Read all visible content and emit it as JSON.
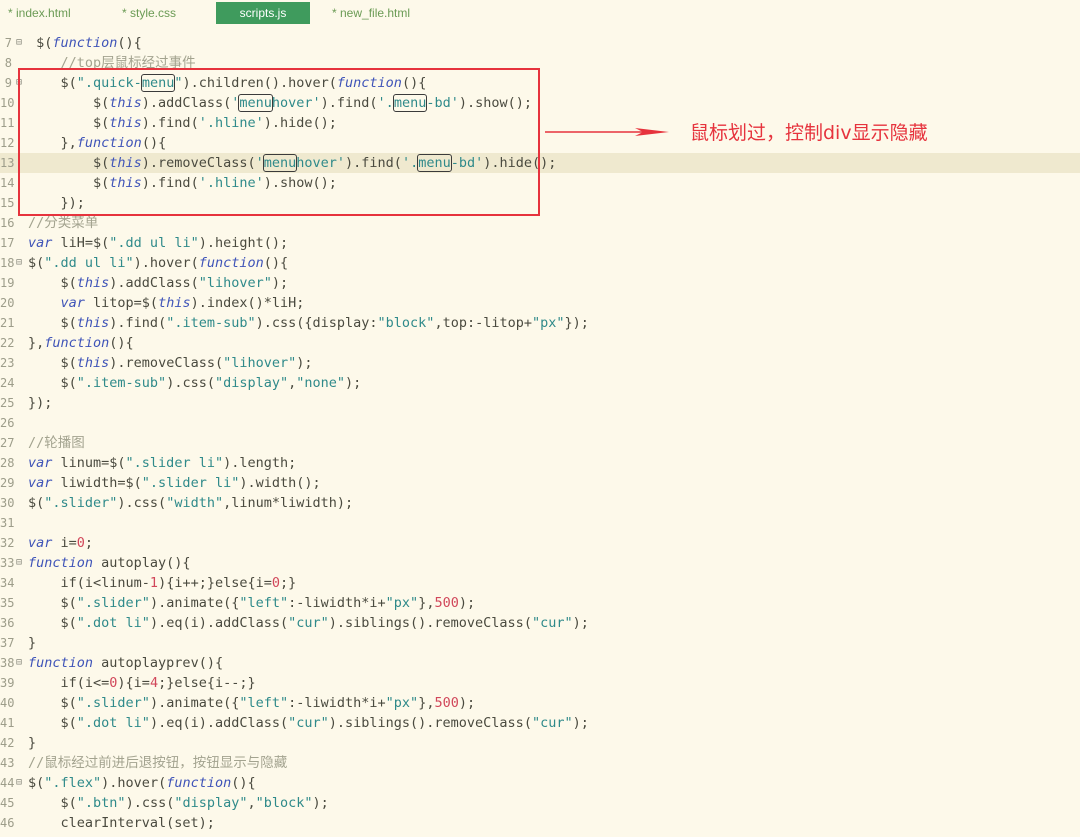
{
  "tabs": [
    {
      "label": "* index.html",
      "active": false
    },
    {
      "label": "* style.css",
      "active": false
    },
    {
      "label": "scripts.js",
      "active": true
    },
    {
      "label": "* new_file.html",
      "active": false
    }
  ],
  "annotation": {
    "text": "鼠标划过，控制div显示隐藏",
    "color": "#e6333d"
  },
  "lines": [
    {
      "n": "7",
      "fold": "⊟",
      "hl": false,
      "parts": [
        [
          "p",
          " $("
        ],
        [
          "kw",
          "function"
        ],
        [
          "p",
          "(){"
        ]
      ]
    },
    {
      "n": "8",
      "fold": "",
      "hl": false,
      "parts": [
        [
          "cm",
          "    //top层鼠标经过事件"
        ]
      ]
    },
    {
      "n": "9",
      "fold": "⊟",
      "hl": false,
      "parts": [
        [
          "p",
          "    $("
        ],
        [
          "str",
          "\".quick-"
        ],
        [
          "strbox",
          "menu"
        ],
        [
          "str",
          "\""
        ],
        [
          "p",
          ").children().hover("
        ],
        [
          "kw",
          "function"
        ],
        [
          "p",
          "(){"
        ]
      ]
    },
    {
      "n": "10",
      "fold": "",
      "hl": false,
      "parts": [
        [
          "p",
          "        $("
        ],
        [
          "kw",
          "this"
        ],
        [
          "p",
          ").addClass("
        ],
        [
          "str",
          "'"
        ],
        [
          "strbox",
          "menu"
        ],
        [
          "str",
          "hover'"
        ],
        [
          "p",
          ").find("
        ],
        [
          "str",
          "'."
        ],
        [
          "strbox",
          "menu"
        ],
        [
          "str",
          "-bd'"
        ],
        [
          "p",
          ").show();"
        ]
      ]
    },
    {
      "n": "11",
      "fold": "",
      "hl": false,
      "parts": [
        [
          "p",
          "        $("
        ],
        [
          "kw",
          "this"
        ],
        [
          "p",
          ").find("
        ],
        [
          "str",
          "'.hline'"
        ],
        [
          "p",
          ").hide();"
        ]
      ]
    },
    {
      "n": "12",
      "fold": "",
      "hl": false,
      "parts": [
        [
          "p",
          "    },"
        ],
        [
          "kw",
          "function"
        ],
        [
          "p",
          "(){"
        ]
      ]
    },
    {
      "n": "13",
      "fold": "",
      "hl": true,
      "parts": [
        [
          "p",
          "        $("
        ],
        [
          "kw",
          "this"
        ],
        [
          "p",
          ").removeClass("
        ],
        [
          "str",
          "'"
        ],
        [
          "strbox",
          "menu"
        ],
        [
          "str",
          "hover'"
        ],
        [
          "p",
          ").find("
        ],
        [
          "str",
          "'."
        ],
        [
          "strbox",
          "menu"
        ],
        [
          "str",
          "-bd'"
        ],
        [
          "p",
          ").hide();"
        ]
      ]
    },
    {
      "n": "14",
      "fold": "",
      "hl": false,
      "parts": [
        [
          "p",
          "        $("
        ],
        [
          "kw",
          "this"
        ],
        [
          "p",
          ").find("
        ],
        [
          "str",
          "'.hline'"
        ],
        [
          "p",
          ").show();"
        ]
      ]
    },
    {
      "n": "15",
      "fold": "",
      "hl": false,
      "parts": [
        [
          "p",
          "    });"
        ]
      ]
    },
    {
      "n": "16",
      "fold": "",
      "hl": false,
      "parts": [
        [
          "cm",
          "//分类菜单"
        ]
      ]
    },
    {
      "n": "17",
      "fold": "",
      "hl": false,
      "parts": [
        [
          "kw",
          "var"
        ],
        [
          "p",
          " liH=$("
        ],
        [
          "str",
          "\".dd ul li\""
        ],
        [
          "p",
          ").height();"
        ]
      ]
    },
    {
      "n": "18",
      "fold": "⊟",
      "hl": false,
      "parts": [
        [
          "p",
          "$("
        ],
        [
          "str",
          "\".dd ul li\""
        ],
        [
          "p",
          ").hover("
        ],
        [
          "kw",
          "function"
        ],
        [
          "p",
          "(){"
        ]
      ]
    },
    {
      "n": "19",
      "fold": "",
      "hl": false,
      "parts": [
        [
          "p",
          "    $("
        ],
        [
          "kw",
          "this"
        ],
        [
          "p",
          ").addClass("
        ],
        [
          "str",
          "\"lihover\""
        ],
        [
          "p",
          ");"
        ]
      ]
    },
    {
      "n": "20",
      "fold": "",
      "hl": false,
      "parts": [
        [
          "p",
          "    "
        ],
        [
          "kw",
          "var"
        ],
        [
          "p",
          " litop=$("
        ],
        [
          "kw",
          "this"
        ],
        [
          "p",
          ").index()*liH;"
        ]
      ]
    },
    {
      "n": "21",
      "fold": "",
      "hl": false,
      "parts": [
        [
          "p",
          "    $("
        ],
        [
          "kw",
          "this"
        ],
        [
          "p",
          ").find("
        ],
        [
          "str",
          "\".item-sub\""
        ],
        [
          "p",
          ").css({display:"
        ],
        [
          "str",
          "\"block\""
        ],
        [
          "p",
          ",top:-litop+"
        ],
        [
          "str",
          "\"px\""
        ],
        [
          "p",
          "});"
        ]
      ]
    },
    {
      "n": "22",
      "fold": "",
      "hl": false,
      "parts": [
        [
          "p",
          "},"
        ],
        [
          "kw",
          "function"
        ],
        [
          "p",
          "(){"
        ]
      ]
    },
    {
      "n": "23",
      "fold": "",
      "hl": false,
      "parts": [
        [
          "p",
          "    $("
        ],
        [
          "kw",
          "this"
        ],
        [
          "p",
          ").removeClass("
        ],
        [
          "str",
          "\"lihover\""
        ],
        [
          "p",
          ");"
        ]
      ]
    },
    {
      "n": "24",
      "fold": "",
      "hl": false,
      "parts": [
        [
          "p",
          "    $("
        ],
        [
          "str",
          "\".item-sub\""
        ],
        [
          "p",
          ").css("
        ],
        [
          "str",
          "\"display\""
        ],
        [
          "p",
          ","
        ],
        [
          "str",
          "\"none\""
        ],
        [
          "p",
          ");"
        ]
      ]
    },
    {
      "n": "25",
      "fold": "",
      "hl": false,
      "parts": [
        [
          "p",
          "});"
        ]
      ]
    },
    {
      "n": "26",
      "fold": "",
      "hl": false,
      "parts": []
    },
    {
      "n": "27",
      "fold": "",
      "hl": false,
      "parts": [
        [
          "cm",
          "//轮播图"
        ]
      ]
    },
    {
      "n": "28",
      "fold": "",
      "hl": false,
      "parts": [
        [
          "kw",
          "var"
        ],
        [
          "p",
          " linum=$("
        ],
        [
          "str",
          "\".slider li\""
        ],
        [
          "p",
          ").length;"
        ]
      ]
    },
    {
      "n": "29",
      "fold": "",
      "hl": false,
      "parts": [
        [
          "kw",
          "var"
        ],
        [
          "p",
          " liwidth=$("
        ],
        [
          "str",
          "\".slider li\""
        ],
        [
          "p",
          ").width();"
        ]
      ]
    },
    {
      "n": "30",
      "fold": "",
      "hl": false,
      "parts": [
        [
          "p",
          "$("
        ],
        [
          "str",
          "\".slider\""
        ],
        [
          "p",
          ").css("
        ],
        [
          "str",
          "\"width\""
        ],
        [
          "p",
          ",linum*liwidth);"
        ]
      ]
    },
    {
      "n": "31",
      "fold": "",
      "hl": false,
      "parts": []
    },
    {
      "n": "32",
      "fold": "",
      "hl": false,
      "parts": [
        [
          "kw",
          "var"
        ],
        [
          "p",
          " i="
        ],
        [
          "num",
          "0"
        ],
        [
          "p",
          ";"
        ]
      ]
    },
    {
      "n": "33",
      "fold": "⊟",
      "hl": false,
      "parts": [
        [
          "kw",
          "function"
        ],
        [
          "p",
          " autoplay(){"
        ]
      ]
    },
    {
      "n": "34",
      "fold": "",
      "hl": false,
      "parts": [
        [
          "p",
          "    if(i<linum-"
        ],
        [
          "num",
          "1"
        ],
        [
          "p",
          "){i++;}else{i="
        ],
        [
          "num",
          "0"
        ],
        [
          "p",
          ";}"
        ]
      ]
    },
    {
      "n": "35",
      "fold": "",
      "hl": false,
      "parts": [
        [
          "p",
          "    $("
        ],
        [
          "str",
          "\".slider\""
        ],
        [
          "p",
          ").animate({"
        ],
        [
          "str",
          "\"left\""
        ],
        [
          "p",
          ":-liwidth*i+"
        ],
        [
          "str",
          "\"px\""
        ],
        [
          "p",
          "},"
        ],
        [
          "num",
          "500"
        ],
        [
          "p",
          ");"
        ]
      ]
    },
    {
      "n": "36",
      "fold": "",
      "hl": false,
      "parts": [
        [
          "p",
          "    $("
        ],
        [
          "str",
          "\".dot li\""
        ],
        [
          "p",
          ").eq(i).addClass("
        ],
        [
          "str",
          "\"cur\""
        ],
        [
          "p",
          ").siblings().removeClass("
        ],
        [
          "str",
          "\"cur\""
        ],
        [
          "p",
          ");"
        ]
      ]
    },
    {
      "n": "37",
      "fold": "",
      "hl": false,
      "parts": [
        [
          "p",
          "}"
        ]
      ]
    },
    {
      "n": "38",
      "fold": "⊟",
      "hl": false,
      "parts": [
        [
          "kw",
          "function"
        ],
        [
          "p",
          " autoplayprev(){"
        ]
      ]
    },
    {
      "n": "39",
      "fold": "",
      "hl": false,
      "parts": [
        [
          "p",
          "    if(i<="
        ],
        [
          "num",
          "0"
        ],
        [
          "p",
          "){i="
        ],
        [
          "num",
          "4"
        ],
        [
          "p",
          ";}else{i--;}"
        ]
      ]
    },
    {
      "n": "40",
      "fold": "",
      "hl": false,
      "parts": [
        [
          "p",
          "    $("
        ],
        [
          "str",
          "\".slider\""
        ],
        [
          "p",
          ").animate({"
        ],
        [
          "str",
          "\"left\""
        ],
        [
          "p",
          ":-liwidth*i+"
        ],
        [
          "str",
          "\"px\""
        ],
        [
          "p",
          "},"
        ],
        [
          "num",
          "500"
        ],
        [
          "p",
          ");"
        ]
      ]
    },
    {
      "n": "41",
      "fold": "",
      "hl": false,
      "parts": [
        [
          "p",
          "    $("
        ],
        [
          "str",
          "\".dot li\""
        ],
        [
          "p",
          ").eq(i).addClass("
        ],
        [
          "str",
          "\"cur\""
        ],
        [
          "p",
          ").siblings().removeClass("
        ],
        [
          "str",
          "\"cur\""
        ],
        [
          "p",
          ");"
        ]
      ]
    },
    {
      "n": "42",
      "fold": "",
      "hl": false,
      "parts": [
        [
          "p",
          "}"
        ]
      ]
    },
    {
      "n": "43",
      "fold": "",
      "hl": false,
      "parts": [
        [
          "cm",
          "//鼠标经过前进后退按钮，按钮显示与隐藏"
        ]
      ]
    },
    {
      "n": "44",
      "fold": "⊟",
      "hl": false,
      "parts": [
        [
          "p",
          "$("
        ],
        [
          "str",
          "\".flex\""
        ],
        [
          "p",
          ").hover("
        ],
        [
          "kw",
          "function"
        ],
        [
          "p",
          "(){"
        ]
      ]
    },
    {
      "n": "45",
      "fold": "",
      "hl": false,
      "parts": [
        [
          "p",
          "    $("
        ],
        [
          "str",
          "\".btn\""
        ],
        [
          "p",
          ").css("
        ],
        [
          "str",
          "\"display\""
        ],
        [
          "p",
          ","
        ],
        [
          "str",
          "\"block\""
        ],
        [
          "p",
          ");"
        ]
      ]
    },
    {
      "n": "46",
      "fold": "",
      "hl": false,
      "parts": [
        [
          "p",
          "    clearInterval(set);"
        ]
      ]
    }
  ]
}
